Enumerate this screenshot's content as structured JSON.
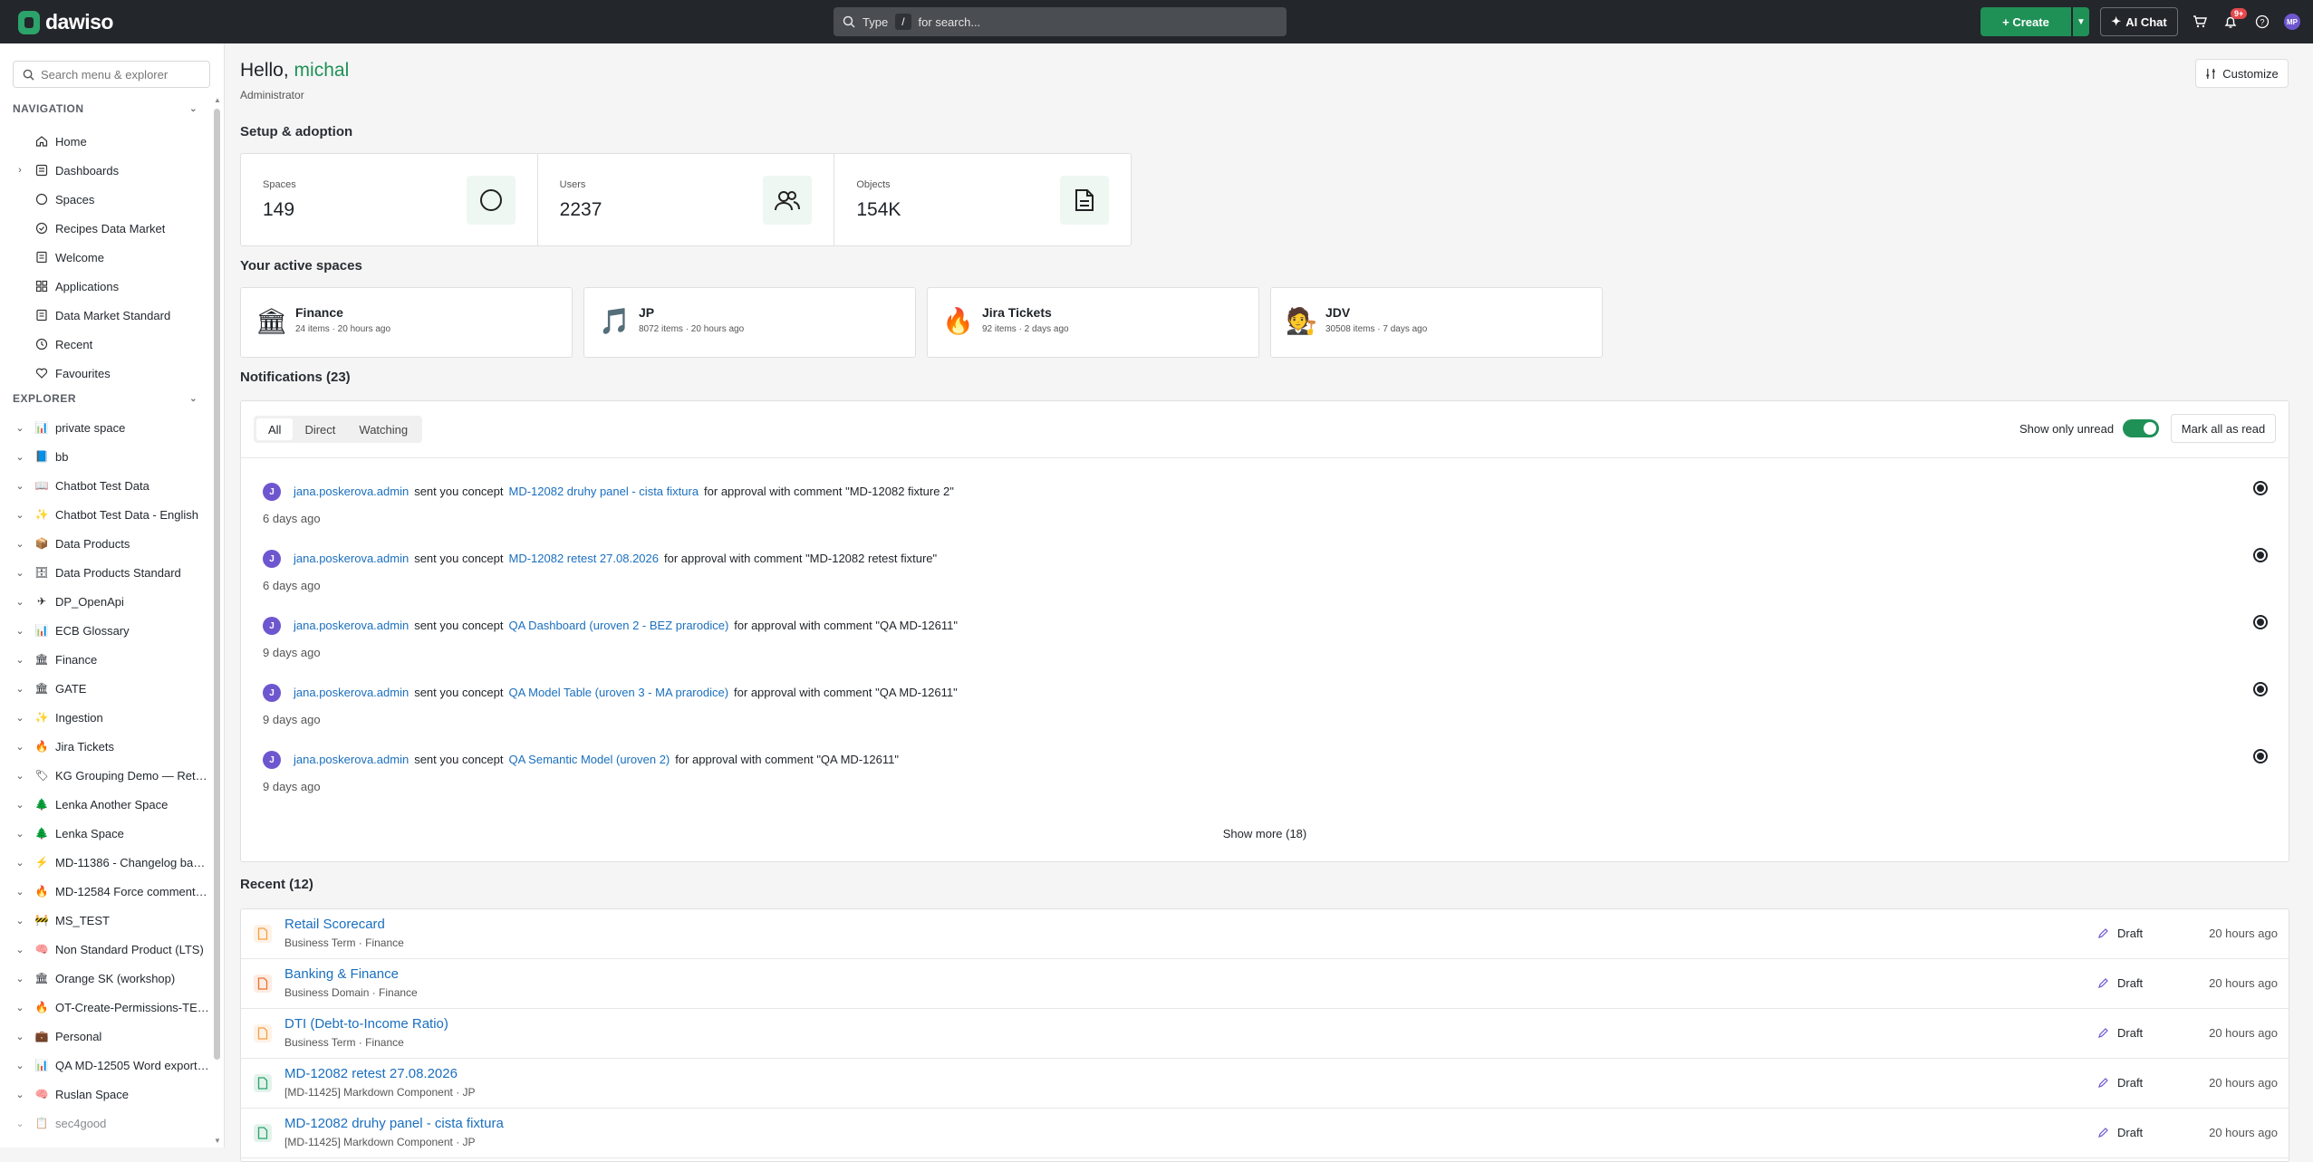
{
  "app": {
    "brand": "dawiso"
  },
  "topbar": {
    "search_type": "Type",
    "search_key": "/",
    "search_placeholder": "for search...",
    "create_label": "+ Create",
    "ai_chat_label": "AI Chat",
    "notification_badge": "9+",
    "avatar_initials": "MP"
  },
  "sidebar": {
    "search_placeholder": "Search menu & explorer",
    "navigation_header": "NAVIGATION",
    "navigation": [
      {
        "label": "Home",
        "icon": "home-icon",
        "expandable": false
      },
      {
        "label": "Dashboards",
        "icon": "dashboard-icon",
        "expandable": true
      },
      {
        "label": "Spaces",
        "icon": "circle-icon",
        "expandable": false
      },
      {
        "label": "Recipes Data Market",
        "icon": "check-circle-icon",
        "expandable": false
      },
      {
        "label": "Welcome",
        "icon": "document-icon",
        "expandable": false
      },
      {
        "label": "Applications",
        "icon": "grid-icon",
        "expandable": false
      },
      {
        "label": "Data Market Standard",
        "icon": "document-icon",
        "expandable": false
      },
      {
        "label": "Recent",
        "icon": "clock-icon",
        "expandable": false
      },
      {
        "label": "Favourites",
        "icon": "heart-icon",
        "expandable": false
      }
    ],
    "explorer_header": "EXPLORER",
    "explorer": [
      {
        "label": "private space",
        "emoji": "📊"
      },
      {
        "label": "bb",
        "emoji": "📘"
      },
      {
        "label": "Chatbot Test Data",
        "emoji": "📖"
      },
      {
        "label": "Chatbot Test Data - English",
        "emoji": "✨"
      },
      {
        "label": "Data Products",
        "emoji": "📦"
      },
      {
        "label": "Data Products Standard",
        "emoji": "🗄"
      },
      {
        "label": "DP_OpenApi",
        "emoji": "✈"
      },
      {
        "label": "ECB Glossary",
        "emoji": "📊"
      },
      {
        "label": "Finance",
        "emoji": "🏛"
      },
      {
        "label": "GATE",
        "emoji": "🏛"
      },
      {
        "label": "Ingestion",
        "emoji": "✨"
      },
      {
        "label": "Jira Tickets",
        "emoji": "🔥"
      },
      {
        "label": "KG Grouping Demo — Retail...",
        "emoji": "🏷"
      },
      {
        "label": "Lenka Another Space",
        "emoji": "🌲"
      },
      {
        "label": "Lenka Space",
        "emoji": "🌲"
      },
      {
        "label": "MD-11386 - Changelog bad...",
        "emoji": "⚡"
      },
      {
        "label": "MD-12584 Force comment f...",
        "emoji": "🔥"
      },
      {
        "label": "MS_TEST",
        "emoji": "🚧"
      },
      {
        "label": "Non Standard Product (LTS)",
        "emoji": "🧠"
      },
      {
        "label": "Orange SK (workshop)",
        "emoji": "🏛"
      },
      {
        "label": "OT-Create-Permissions-TEST",
        "emoji": "🔥"
      },
      {
        "label": "Personal",
        "emoji": "💼"
      },
      {
        "label": "QA MD-12505 Word export ...",
        "emoji": "📊"
      },
      {
        "label": "Ruslan Space",
        "emoji": "🧠"
      },
      {
        "label": "sec4good",
        "emoji": "📋"
      }
    ]
  },
  "header": {
    "greeting": "Hello,",
    "user": "michal",
    "role": "Administrator",
    "customize_label": "Customize"
  },
  "setup": {
    "title": "Setup & adoption",
    "stats": [
      {
        "label": "Spaces",
        "value": "149",
        "icon": "circle-icon"
      },
      {
        "label": "Users",
        "value": "2237",
        "icon": "users-icon"
      },
      {
        "label": "Objects",
        "value": "154K",
        "icon": "document-icon"
      }
    ]
  },
  "active_spaces": {
    "title": "Your active spaces",
    "items": [
      {
        "name": "Finance",
        "meta": "24 items · 20 hours ago",
        "emoji": "🏛"
      },
      {
        "name": "JP",
        "meta": "8072 items · 20 hours ago",
        "emoji": "🎵"
      },
      {
        "name": "Jira Tickets",
        "meta": "92 items · 2 days ago",
        "emoji": "🔥"
      },
      {
        "name": "JDV",
        "meta": "30508 items · 7 days ago",
        "emoji": "🧑‍⚖️"
      }
    ]
  },
  "notifications": {
    "title": "Notifications (23)",
    "tabs": [
      "All",
      "Direct",
      "Watching"
    ],
    "active_tab": "All",
    "show_only_unread_label": "Show only unread",
    "mark_all_label": "Mark all as read",
    "items": [
      {
        "avatar": "J",
        "user": "jana.poskerova.admin",
        "action": "sent you concept",
        "concept": "MD-12082 druhy panel - cista fixtura",
        "suffix": "for approval with comment \"MD-12082 fixture 2\"",
        "time": "6 days ago"
      },
      {
        "avatar": "J",
        "user": "jana.poskerova.admin",
        "action": "sent you concept",
        "concept": "MD-12082 retest 27.08.2026",
        "suffix": "for approval with comment \"MD-12082 retest fixture\"",
        "time": "6 days ago"
      },
      {
        "avatar": "J",
        "user": "jana.poskerova.admin",
        "action": "sent you concept",
        "concept": "QA Dashboard (uroven 2 - BEZ prarodice)",
        "suffix": "for approval with comment \"QA MD-12611\"",
        "time": "9 days ago"
      },
      {
        "avatar": "J",
        "user": "jana.poskerova.admin",
        "action": "sent you concept",
        "concept": "QA Model Table (uroven 3 - MA prarodice)",
        "suffix": "for approval with comment \"QA MD-12611\"",
        "time": "9 days ago"
      },
      {
        "avatar": "J",
        "user": "jana.poskerova.admin",
        "action": "sent you concept",
        "concept": "QA Semantic Model (uroven 2)",
        "suffix": "for approval with comment \"QA MD-12611\"",
        "time": "9 days ago"
      }
    ],
    "show_more_label": "Show more (18)"
  },
  "recent": {
    "title": "Recent (12)",
    "items": [
      {
        "title": "Retail Scorecard",
        "subtitle": "Business Term · Finance",
        "status": "Draft",
        "time": "20 hours ago",
        "icon_color": "#f59e42"
      },
      {
        "title": "Banking & Finance",
        "subtitle": "Business Domain · Finance",
        "status": "Draft",
        "time": "20 hours ago",
        "icon_color": "#e8732d"
      },
      {
        "title": "DTI (Debt-to-Income Ratio)",
        "subtitle": "Business Term · Finance",
        "status": "Draft",
        "time": "20 hours ago",
        "icon_color": "#f59e42"
      },
      {
        "title": "MD-12082 retest 27.08.2026",
        "subtitle": "[MD-11425] Markdown Component · JP",
        "status": "Draft",
        "time": "20 hours ago",
        "icon_color": "#2ba36b"
      },
      {
        "title": "MD-12082 druhy panel - cista fixtura",
        "subtitle": "[MD-11425] Markdown Component · JP",
        "status": "Draft",
        "time": "20 hours ago",
        "icon_color": "#2ba36b"
      }
    ]
  }
}
